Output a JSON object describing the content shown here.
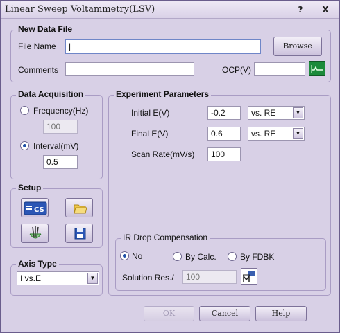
{
  "window": {
    "title": "Linear Sweep Voltammetry(LSV)",
    "help_label": "?",
    "close_label": "X"
  },
  "new_data_file": {
    "legend": "New Data File",
    "file_name_label": "File Name",
    "file_name_value": "|",
    "browse_label": "Browse",
    "comments_label": "Comments",
    "comments_value": "",
    "ocp_label": "OCP(V)",
    "ocp_value": ""
  },
  "data_acquisition": {
    "legend": "Data Acquisition",
    "frequency_label": "Frequency(Hz)",
    "frequency_value": "100",
    "interval_label": "Interval(mV)",
    "interval_value": "0.5",
    "selected": "interval"
  },
  "experiment_parameters": {
    "legend": "Experiment Parameters",
    "initial_e_label": "Initial E(V)",
    "initial_e_value": "-0.2",
    "initial_e_ref": "vs. RE",
    "final_e_label": "Final E(V)",
    "final_e_value": "0.6",
    "final_e_ref": "vs. RE",
    "scan_rate_label": "Scan Rate(mV/s)",
    "scan_rate_value": "100"
  },
  "setup": {
    "legend": "Setup",
    "icons": [
      "cs-instrument-icon",
      "open-folder-icon",
      "electrode-cell-icon",
      "save-disk-icon"
    ],
    "cs_text": "CS"
  },
  "axis_type": {
    "legend": "Axis Type",
    "selected": "I vs.E"
  },
  "ir_drop": {
    "legend": "IR Drop Compensation",
    "no_label": "No",
    "calc_label": "By Calc.",
    "fdbk_label": "By FDBK",
    "selected": "no",
    "solution_res_label": "Solution Res./",
    "solution_res_value": "100"
  },
  "footer": {
    "ok_label": "OK",
    "cancel_label": "Cancel",
    "help_label": "Help"
  },
  "colors": {
    "window_bg": "#d8d0e6",
    "accent": "#1f4fa6",
    "ocp_icon_bg": "#1b8a3a"
  }
}
